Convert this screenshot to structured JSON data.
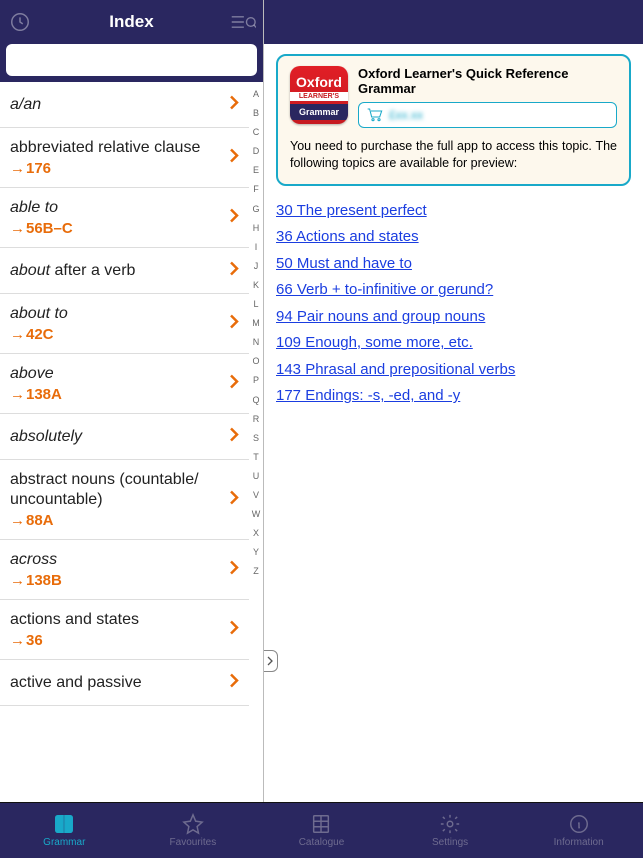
{
  "left": {
    "title": "Index",
    "search_value": "",
    "search_placeholder": "",
    "history_icon": "clock-icon",
    "filter_icon": "filter-list-icon",
    "az": [
      "A",
      "B",
      "C",
      "D",
      "E",
      "F",
      "G",
      "H",
      "I",
      "J",
      "K",
      "L",
      "M",
      "N",
      "O",
      "P",
      "Q",
      "R",
      "S",
      "T",
      "U",
      "V",
      "W",
      "X",
      "Y",
      "Z"
    ],
    "items": [
      {
        "term_html": "<span class='ital'>a/an</span>",
        "ref": ""
      },
      {
        "term_html": "abbreviated relative clause",
        "ref": "176"
      },
      {
        "term_html": "<span class='ital'>able to</span>",
        "ref": "56B–C"
      },
      {
        "term_html": "<span class='ital'>about</span> after a verb",
        "ref": ""
      },
      {
        "term_html": "<span class='ital'>about to</span>",
        "ref": "42C"
      },
      {
        "term_html": "<span class='ital'>above</span>",
        "ref": "138A"
      },
      {
        "term_html": "<span class='ital'>absolutely</span>",
        "ref": ""
      },
      {
        "term_html": "abstract nouns (countable/<br>uncountable)",
        "ref": "88A"
      },
      {
        "term_html": "<span class='ital'>across</span>",
        "ref": "138B"
      },
      {
        "term_html": "actions and states",
        "ref": "36"
      },
      {
        "term_html": "active and passive",
        "ref": ""
      }
    ]
  },
  "right": {
    "product_title": "Oxford Learner's Quick Reference Grammar",
    "app_icon": {
      "line1": "Oxford",
      "line2": "LEARNER'S",
      "line3": "Grammar"
    },
    "price_masked": "£xx.xx",
    "purchase_msg": "You need to purchase the full app to access this topic. The following topics are available for preview:",
    "preview_links": [
      "30 The present perfect",
      "36 Actions and states",
      "50 Must and have to",
      "66 Verb + to-infinitive or gerund?",
      "94 Pair nouns and group nouns",
      "109 Enough, some more, etc.",
      "143 Phrasal and prepositional verbs",
      "177 Endings: -s, -ed, and -y"
    ]
  },
  "tabs": [
    {
      "id": "grammar",
      "label": "Grammar",
      "icon": "book-icon",
      "active": true
    },
    {
      "id": "favourites",
      "label": "Favourites",
      "icon": "star-icon",
      "active": false
    },
    {
      "id": "catalogue",
      "label": "Catalogue",
      "icon": "grid-icon",
      "active": false
    },
    {
      "id": "settings",
      "label": "Settings",
      "icon": "gear-icon",
      "active": false
    },
    {
      "id": "information",
      "label": "Information",
      "icon": "info-icon",
      "active": false
    }
  ]
}
